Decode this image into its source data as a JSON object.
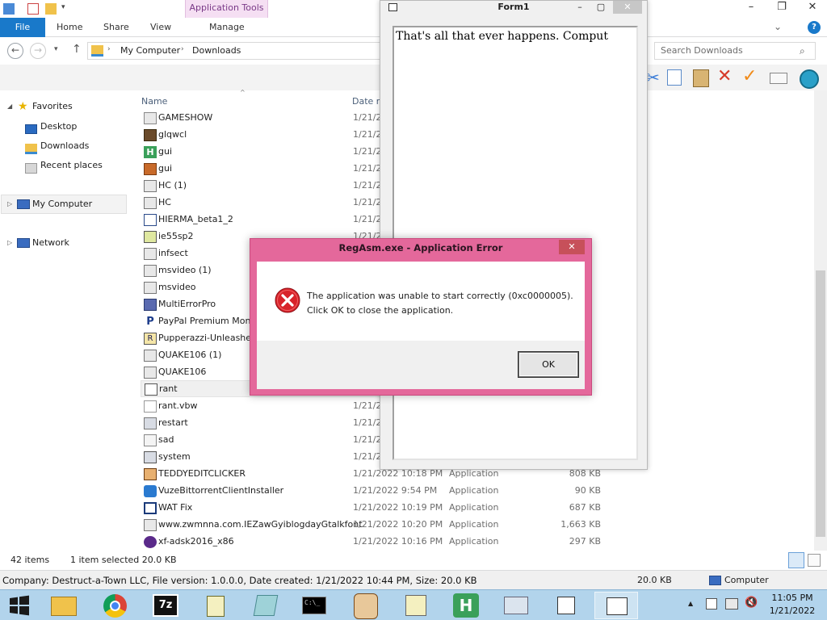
{
  "explorer": {
    "context_tab": "Application Tools",
    "ribbon_tabs": [
      "File",
      "Home",
      "Share",
      "View",
      "Manage"
    ],
    "breadcrumb": [
      "My Computer",
      "Downloads"
    ],
    "search_placeholder": "Search Downloads",
    "nav": {
      "favorites": "Favorites",
      "desktop": "Desktop",
      "downloads": "Downloads",
      "recent": "Recent places",
      "my_computer": "My Computer",
      "network": "Network"
    },
    "columns": {
      "name": "Name",
      "date": "Date m"
    },
    "files": [
      {
        "name": "GAMESHOW",
        "date": "1/21/2",
        "type": "",
        "size": ""
      },
      {
        "name": "glqwcl",
        "date": "1/21/2",
        "type": "",
        "size": ""
      },
      {
        "name": "gui",
        "date": "1/21/2",
        "type": "",
        "size": ""
      },
      {
        "name": "gui",
        "date": "1/21/2",
        "type": "",
        "size": ""
      },
      {
        "name": "HC (1)",
        "date": "1/21/2",
        "type": "",
        "size": ""
      },
      {
        "name": "HC",
        "date": "1/21/2",
        "type": "",
        "size": ""
      },
      {
        "name": "HIERMA_beta1_2",
        "date": "1/21/2",
        "type": "",
        "size": ""
      },
      {
        "name": "ie55sp2",
        "date": "1/21/2",
        "type": "",
        "size": ""
      },
      {
        "name": "infsect",
        "date": "",
        "type": "",
        "size": ""
      },
      {
        "name": "msvideo (1)",
        "date": "",
        "type": "",
        "size": ""
      },
      {
        "name": "msvideo",
        "date": "",
        "type": "",
        "size": ""
      },
      {
        "name": "MultiErrorPro",
        "date": "",
        "type": "",
        "size": ""
      },
      {
        "name": "PayPal Premium Money",
        "date": "",
        "type": "",
        "size": ""
      },
      {
        "name": "Pupperazzi-Unleashed",
        "date": "",
        "type": "",
        "size": ""
      },
      {
        "name": "QUAKE106 (1)",
        "date": "",
        "type": "",
        "size": ""
      },
      {
        "name": "QUAKE106",
        "date": "",
        "type": "",
        "size": ""
      },
      {
        "name": "rant",
        "date": "",
        "type": "",
        "size": ""
      },
      {
        "name": "rant.vbw",
        "date": "1/21/2",
        "type": "",
        "size": ""
      },
      {
        "name": "restart",
        "date": "1/21/2",
        "type": "",
        "size": ""
      },
      {
        "name": "sad",
        "date": "1/21/2",
        "type": "",
        "size": ""
      },
      {
        "name": "system",
        "date": "1/21/2",
        "type": "",
        "size": ""
      },
      {
        "name": "TEDDYEDITCLICKER",
        "date": "1/21/2022 10:18 PM",
        "type": "Application",
        "size": "808 KB"
      },
      {
        "name": "VuzeBittorrentClientInstaller",
        "date": "1/21/2022 9:54 PM",
        "type": "Application",
        "size": "90 KB"
      },
      {
        "name": "WAT Fix",
        "date": "1/21/2022 10:19 PM",
        "type": "Application",
        "size": "687 KB"
      },
      {
        "name": "www.zwmnna.com.IEZawGyiblogdayGtalkfont",
        "date": "1/21/2022 10:20 PM",
        "type": "Application",
        "size": "1,663 KB"
      },
      {
        "name": "xf-adsk2016_x86",
        "date": "1/21/2022 10:16 PM",
        "type": "Application",
        "size": "297 KB"
      }
    ],
    "status": {
      "items": "42 items",
      "selected": "1 item selected  20.0 KB"
    },
    "details": {
      "text": "Company: Destruct-a-Town LLC, File version: 1.0.0.0, Date created: 1/21/2022 10:44 PM, Size: 20.0 KB",
      "size": "20.0 KB",
      "location": "Computer"
    }
  },
  "form1": {
    "title": "Form1",
    "text": "That's all that ever happens. Comput"
  },
  "dialog": {
    "title": "RegAsm.exe - Application Error",
    "message": "The application was unable to start correctly (0xc0000005). Click OK to close the application.",
    "ok_label": "OK",
    "accent_color": "#e4689b"
  },
  "taskbar": {
    "time": "11:05 PM",
    "date": "1/21/2022"
  }
}
